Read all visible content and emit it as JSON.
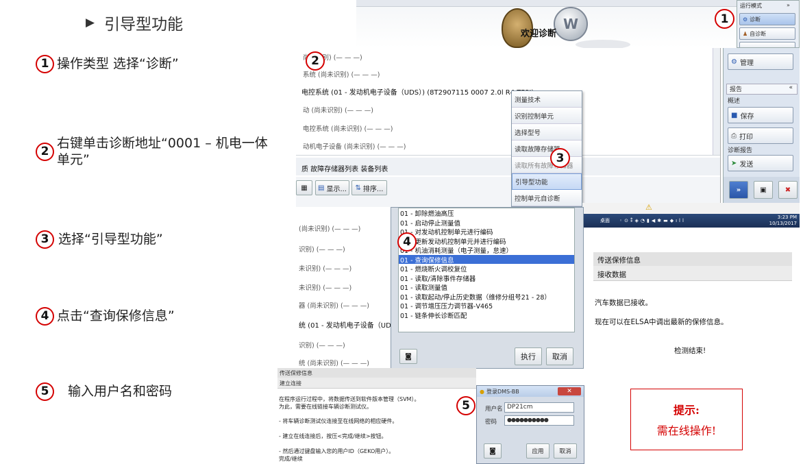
{
  "title": "引导型功能",
  "steps": [
    {
      "n": "1",
      "text": "操作类型 选择“诊断”"
    },
    {
      "n": "2",
      "text": "右键单击诊断地址“0001 – 机电一体单元”"
    },
    {
      "n": "3",
      "text": "选择“引导型功能”"
    },
    {
      "n": "4",
      "text": "点击“查询保修信息”"
    },
    {
      "n": "5",
      "text": "输入用户名和密码"
    }
  ],
  "shot1": {
    "welcome": "欢迎诊断",
    "mode_header": "运行模式",
    "mode_items": [
      "诊断",
      "自诊断"
    ]
  },
  "shot2": {
    "rows": [
      "尚未识别) (— — —)",
      "系统 (尚未识别) (— — —)",
      "电控系统 (01 - 发动机电子设备（UDS）) (8T2907115  0007  2.0l R4 TFSI)",
      "动 (尚未识别) (— — —)",
      "电控系统 (尚未识别) (— — —)",
      "动机电子设备 (尚未识别) (— — —)"
    ],
    "bottom_tabs": "质  故障存储器列表  装备列表",
    "buttons": [
      "显示...",
      "排序..."
    ],
    "context_menu": [
      "测量技术",
      "识别控制单元",
      "选择型号",
      "读取故障存储器",
      "读取所有故障存储器",
      "引导型功能",
      "控制单元自诊断"
    ]
  },
  "shot3": {
    "manage": "管理",
    "report": "报告",
    "overview": "概述",
    "save": "保存",
    "print": "打印",
    "diag_report": "诊断报告",
    "send": "发送",
    "time": "3:23 PM",
    "date": "10/13/2017",
    "taskbar_lang": "桌面"
  },
  "shot4": {
    "left_rows": [
      "(尚未识别) (— — —)",
      "识别) (— — —)",
      "未识别) (— — —)",
      "未识别) (— — —)",
      "器 (尚未识别) (— — —)",
      "统 (01 - 发动机电子设备（UD",
      "识别) (— — —)",
      "统 (尚未识别) (— — —)"
    ],
    "items": [
      "01 - 卸除燃油高压",
      "01 - 启动停止测量值",
      "01 - 对发动机控制单元进行编码",
      "01 - 更新发动机控制单元并进行编码",
      "01 - 机油消耗测量（电子测量，怠速）",
      "01 - 查询保修信息",
      "01 - 燃烧断火调校复位",
      "01 - 读取/清除事件存储器",
      "01 - 读取测量值",
      "01 - 读取起动/停止历史数据（维修分组号21 - 28）",
      "01 - 调节增压压力调节器-V465",
      "01 - 链条伸长诊断匹配"
    ],
    "selected": 5,
    "execute": "执行",
    "cancel": "取消"
  },
  "shot5": {
    "header1": "传送保修信息",
    "header2": "接收数据",
    "line1": "汽车数据已接收。",
    "line2": "现在可以在ELSA中调出最新的保修信息。",
    "line3": "检测结束!"
  },
  "shot6": {
    "header1": "传送保修信息",
    "header2": "建立连接",
    "lines": [
      "在程序运行过程中，将数据传送到软件版本管理（SVM）。",
      "为此，需要在线链接车辆诊断测试仪。",
      "- 将车辆诊断测试仪连接至在线网络的相应硬件。",
      "- 建立在线连接后，按压<完成/继续>按钮。",
      "- 然后通过键盘输入您的用户ID（GEKO用户）。",
      "完成/继续"
    ],
    "dialog_title": "登录DMS-BB",
    "user_label": "用户名",
    "user_value": "DP21cm",
    "pwd_label": "密码",
    "pwd_value": "●●●●●●●●●●",
    "apply": "应用",
    "cancel": "取消"
  },
  "tip": {
    "title": "提示:",
    "text": "需在线操作!"
  },
  "colors": {
    "accent": "#d40000",
    "selection": "#3b6fd6"
  }
}
